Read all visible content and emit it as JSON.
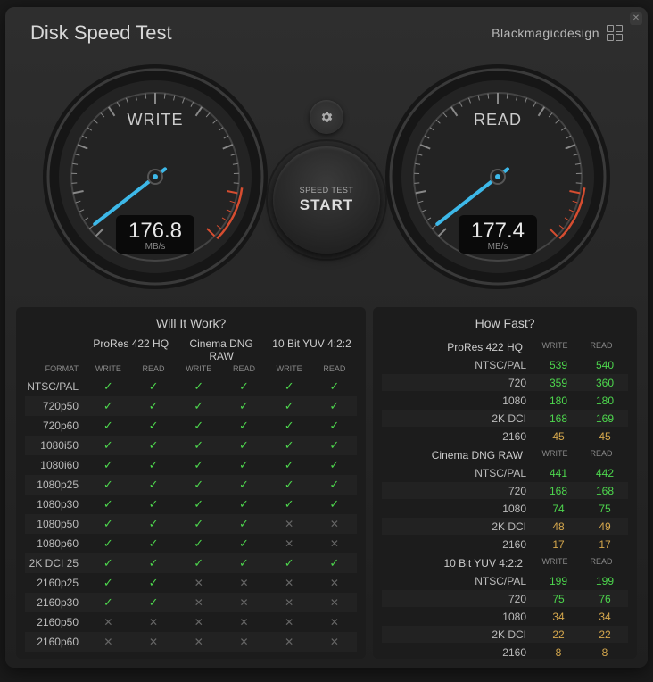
{
  "title": "Disk Speed Test",
  "brand": "Blackmagicdesign",
  "gauges": {
    "write": {
      "label": "WRITE",
      "value": "176.8",
      "unit": "MB/s",
      "needle_angle": -128
    },
    "read": {
      "label": "READ",
      "value": "177.4",
      "unit": "MB/s",
      "needle_angle": -128
    }
  },
  "start_button": {
    "small": "SPEED TEST",
    "big": "START"
  },
  "will_it_work": {
    "title": "Will It Work?",
    "format_label": "FORMAT",
    "codecs": [
      "ProRes 422 HQ",
      "Cinema DNG RAW",
      "10 Bit YUV 4:2:2"
    ],
    "rw_labels": [
      "WRITE",
      "READ"
    ],
    "rows": [
      {
        "label": "NTSC/PAL",
        "cells": [
          "y",
          "y",
          "y",
          "y",
          "y",
          "y"
        ]
      },
      {
        "label": "720p50",
        "cells": [
          "y",
          "y",
          "y",
          "y",
          "y",
          "y"
        ]
      },
      {
        "label": "720p60",
        "cells": [
          "y",
          "y",
          "y",
          "y",
          "y",
          "y"
        ]
      },
      {
        "label": "1080i50",
        "cells": [
          "y",
          "y",
          "y",
          "y",
          "y",
          "y"
        ]
      },
      {
        "label": "1080i60",
        "cells": [
          "y",
          "y",
          "y",
          "y",
          "y",
          "y"
        ]
      },
      {
        "label": "1080p25",
        "cells": [
          "y",
          "y",
          "y",
          "y",
          "y",
          "y"
        ]
      },
      {
        "label": "1080p30",
        "cells": [
          "y",
          "y",
          "y",
          "y",
          "y",
          "y"
        ]
      },
      {
        "label": "1080p50",
        "cells": [
          "y",
          "y",
          "y",
          "y",
          "n",
          "n"
        ]
      },
      {
        "label": "1080p60",
        "cells": [
          "y",
          "y",
          "y",
          "y",
          "n",
          "n"
        ]
      },
      {
        "label": "2K DCI 25",
        "cells": [
          "y",
          "y",
          "y",
          "y",
          "y",
          "y"
        ]
      },
      {
        "label": "2160p25",
        "cells": [
          "y",
          "y",
          "n",
          "n",
          "n",
          "n"
        ]
      },
      {
        "label": "2160p30",
        "cells": [
          "y",
          "y",
          "n",
          "n",
          "n",
          "n"
        ]
      },
      {
        "label": "2160p50",
        "cells": [
          "n",
          "n",
          "n",
          "n",
          "n",
          "n"
        ]
      },
      {
        "label": "2160p60",
        "cells": [
          "n",
          "n",
          "n",
          "n",
          "n",
          "n"
        ]
      }
    ]
  },
  "how_fast": {
    "title": "How Fast?",
    "rw_labels": [
      "WRITE",
      "READ"
    ],
    "sections": [
      {
        "codec": "ProRes 422 HQ",
        "rows": [
          {
            "label": "NTSC/PAL",
            "write": "539",
            "read": "540",
            "wc": "g",
            "rc": "g"
          },
          {
            "label": "720",
            "write": "359",
            "read": "360",
            "wc": "g",
            "rc": "g"
          },
          {
            "label": "1080",
            "write": "180",
            "read": "180",
            "wc": "g",
            "rc": "g"
          },
          {
            "label": "2K DCI",
            "write": "168",
            "read": "169",
            "wc": "g",
            "rc": "g"
          },
          {
            "label": "2160",
            "write": "45",
            "read": "45",
            "wc": "o",
            "rc": "o"
          }
        ]
      },
      {
        "codec": "Cinema DNG RAW",
        "rows": [
          {
            "label": "NTSC/PAL",
            "write": "441",
            "read": "442",
            "wc": "g",
            "rc": "g"
          },
          {
            "label": "720",
            "write": "168",
            "read": "168",
            "wc": "g",
            "rc": "g"
          },
          {
            "label": "1080",
            "write": "74",
            "read": "75",
            "wc": "g",
            "rc": "g"
          },
          {
            "label": "2K DCI",
            "write": "48",
            "read": "49",
            "wc": "o",
            "rc": "o"
          },
          {
            "label": "2160",
            "write": "17",
            "read": "17",
            "wc": "o",
            "rc": "o"
          }
        ]
      },
      {
        "codec": "10 Bit YUV 4:2:2",
        "rows": [
          {
            "label": "NTSC/PAL",
            "write": "199",
            "read": "199",
            "wc": "g",
            "rc": "g"
          },
          {
            "label": "720",
            "write": "75",
            "read": "76",
            "wc": "g",
            "rc": "g"
          },
          {
            "label": "1080",
            "write": "34",
            "read": "34",
            "wc": "o",
            "rc": "o"
          },
          {
            "label": "2K DCI",
            "write": "22",
            "read": "22",
            "wc": "o",
            "rc": "o"
          },
          {
            "label": "2160",
            "write": "8",
            "read": "8",
            "wc": "o",
            "rc": "o"
          }
        ]
      }
    ]
  }
}
